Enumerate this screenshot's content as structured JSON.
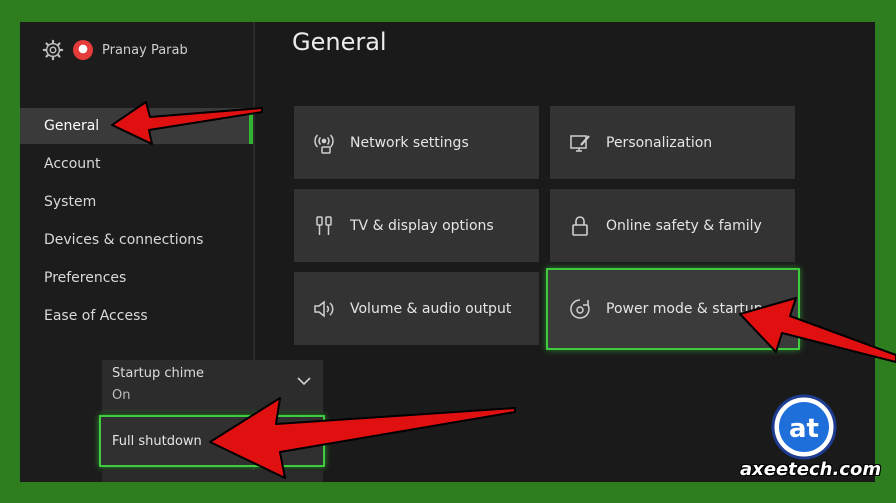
{
  "user": {
    "name": "Pranay Parab"
  },
  "page": {
    "title": "General"
  },
  "sidebar": {
    "items": [
      {
        "label": "General",
        "active": true
      },
      {
        "label": "Account"
      },
      {
        "label": "System"
      },
      {
        "label": "Devices & connections"
      },
      {
        "label": "Preferences"
      },
      {
        "label": "Ease of Access"
      }
    ]
  },
  "tiles": [
    {
      "label": "Network settings",
      "icon": "network-icon"
    },
    {
      "label": "Personalization",
      "icon": "personalization-icon"
    },
    {
      "label": "TV & display options",
      "icon": "tv-display-icon"
    },
    {
      "label": "Online safety & family",
      "icon": "lock-icon"
    },
    {
      "label": "Volume & audio output",
      "icon": "speaker-icon"
    },
    {
      "label": "Power mode & startup",
      "icon": "power-mode-icon",
      "selected": true
    }
  ],
  "startup_chime": {
    "title": "Startup chime",
    "value": "On"
  },
  "full_shutdown": {
    "label": "Full shutdown"
  },
  "watermark": {
    "site": "axeetech.com"
  },
  "colors": {
    "accent": "#3ecb3e",
    "arrow": "#e01010",
    "frame": "#2e7d1f"
  }
}
